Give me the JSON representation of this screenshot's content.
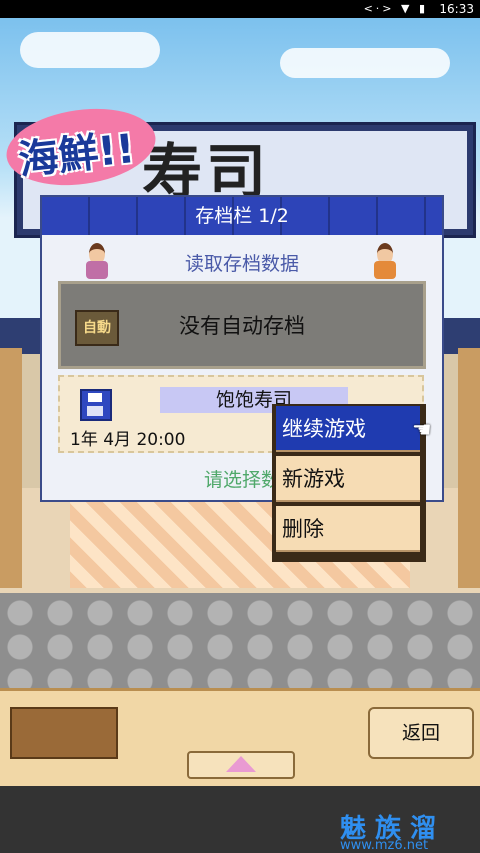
{
  "status_bar": {
    "icons": "<·> ▼ ▮",
    "time": "16:33"
  },
  "scene": {
    "logo_text": "海鮮!!",
    "shop_sign_text": "寿司"
  },
  "save_panel": {
    "title": "存档栏 1/2",
    "subtitle": "读取存档数据",
    "autosave": {
      "icon_text": "自動",
      "text": "没有自动存档"
    },
    "slot": {
      "name": "饱饱寿司",
      "date": "1年 4月 20:00"
    },
    "hint": "请选择数"
  },
  "context_menu": {
    "items": [
      {
        "label": "继续游戏",
        "active": true
      },
      {
        "label": "新游戏",
        "active": false
      },
      {
        "label": "删除",
        "active": false
      }
    ]
  },
  "footer": {
    "back_label": "返回"
  },
  "watermark": {
    "title": "魅族溜",
    "url": "www.mz6.net"
  },
  "colors": {
    "header_blue": "#2d44b8",
    "menu_active": "#1f3bb0",
    "hint_green": "#4fa86a",
    "watermark": "#2f8ff0"
  }
}
